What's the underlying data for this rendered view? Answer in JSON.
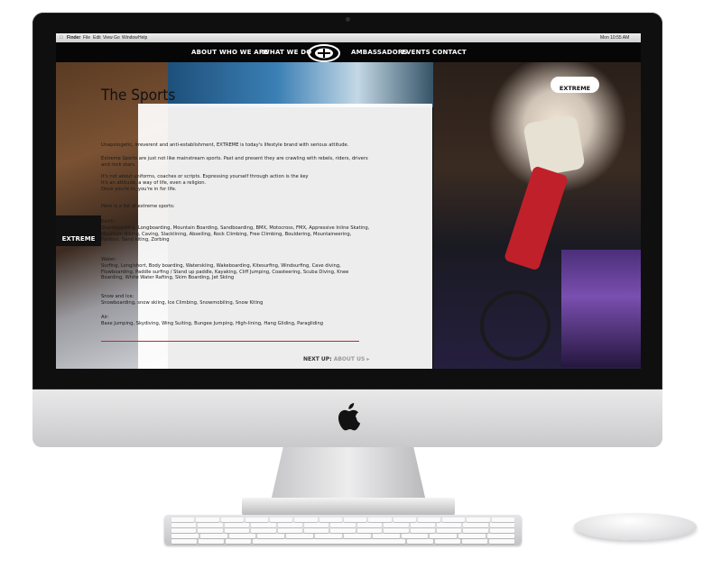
{
  "menubar": {
    "items": [
      "Finder",
      "File",
      "Edit",
      "View",
      "Go",
      "Window",
      "Help"
    ],
    "clock": "Mon 10:55 AM"
  },
  "nav": {
    "left": [
      "ABOUT",
      "WHO WE ARE",
      "WHAT WE DO"
    ],
    "right": [
      "AMBASSADORS",
      "EVENTS",
      "CONTACT"
    ]
  },
  "brand": {
    "logo_text": "EXTREME"
  },
  "content": {
    "title": "The Sports",
    "intro": "Unapologetic, irreverent and anti-establishment, EXTREME is today's lifestyle brand with serious attitude.",
    "para1": "Extreme Sports are just not like mainstream sports. Past and present they are crawling with rebels, riders, drivers and rock stars.",
    "para2": "It's not about uniforms, coaches or scripts. Expressing yourself through action is the key",
    "para3": "It's an attitude, a way of life, even a religion.",
    "para4": "Once you're in, you're in for life.",
    "list_intro": "Here is a list of extreme sports:",
    "earth_label": "Earth:",
    "earth": "Skateboarding, Longboarding, Mountain Boarding, Sandboarding, BMX, Motocross, FMX, Appressive Inline Skating, Mountain Biking, Caving, Slacklining, Abseiling, Rock Climbing, Free Climbing, Bouldering, Mountaineering, Parkour, Sand kiting, Zorbing",
    "water_label": "Water:",
    "water": "Surfing, Long/short, Body boarding, Waterskiing, Wakeboarding, Kitesurfing, Windsurfing, Cave diving, Flowboarding, Paddle surfing / Stand up paddle, Kayaking, Cliff Jumping, Coasteering, Scuba Diving, Knee Boarding, White Water Rafting, Skim Boarding, Jet Skiing",
    "snow_label": "Snow and Ice:",
    "snow": "Snowboarding, snow skiing, Ice Climbing, Snowmobiling, Snow Kiting",
    "air_label": "Air:",
    "air": "Base Jumping, Skydiving, Wing Suiting, Bungee Jumping, High-lining, Hang Gliding, Paragliding",
    "next_label": "NEXT UP:",
    "next_link": "ABOUT US"
  },
  "photos": {
    "banner_left": "EXTREME",
    "cap": "EXTREME"
  }
}
